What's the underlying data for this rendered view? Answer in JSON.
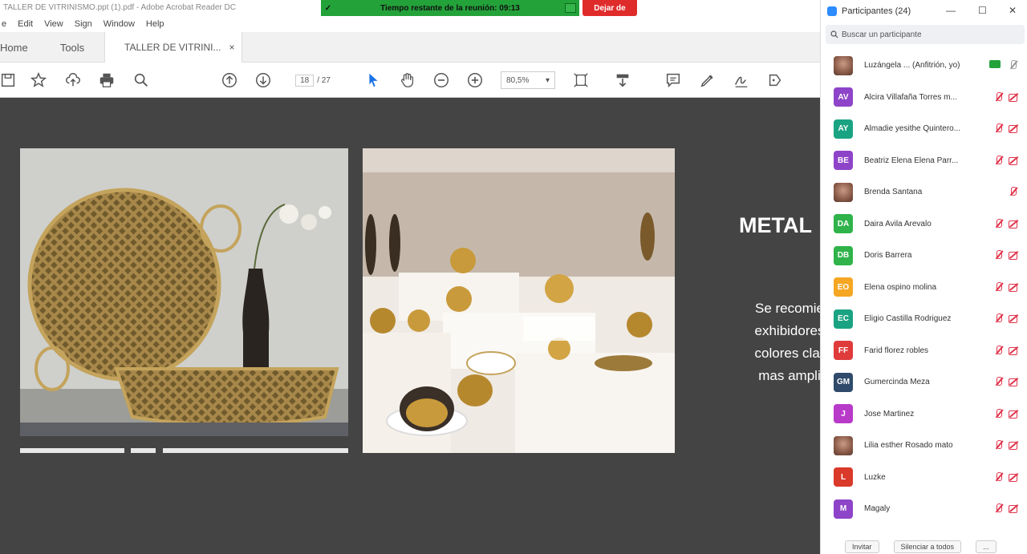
{
  "window": {
    "title": "TALLER DE VITRINISMO.ppt (1).pdf - Adobe Acrobat Reader DC",
    "meeting_banner": "Tiempo restante de la reunión: 09:13",
    "leave_label": "Dejar de"
  },
  "menu": [
    "e",
    "Edit",
    "View",
    "Sign",
    "Window",
    "Help"
  ],
  "tabs": {
    "home": "Home",
    "tools": "Tools",
    "doc": "TALLER DE VITRINI...",
    "doc_close": "×"
  },
  "toolbar": {
    "page_current": "18",
    "page_total": "/ 27",
    "zoom": "80,5%",
    "icons": [
      "save-icon",
      "bookmark-star-icon",
      "upload-icon",
      "print-icon",
      "search-icon",
      "page-up-icon",
      "page-down-icon",
      "select-arrow-icon",
      "hand-icon",
      "zoom-out-icon",
      "zoom-in-icon",
      "fit-page-icon",
      "scroll-icon",
      "comment-icon",
      "pen-icon",
      "sign-icon",
      "share-icon"
    ]
  },
  "slide": {
    "title": "METAL",
    "body_lines": [
      "Se recomie",
      "exhibidores",
      "colores clar",
      "mas ampli"
    ]
  },
  "panel": {
    "title": "Participantes (24)",
    "search_placeholder": "Buscar un participante",
    "participants": [
      {
        "initials": "",
        "name": "Luzángela ... (Anfitrión, yo)",
        "color": "",
        "photo": true,
        "host": true
      },
      {
        "initials": "AV",
        "name": "Alcira Villafaña Torres m...",
        "color": "#8e44c9"
      },
      {
        "initials": "AY",
        "name": "Almadie yesithe Quintero...",
        "color": "#1aa382"
      },
      {
        "initials": "BE",
        "name": "Beatriz Elena Elena Parr...",
        "color": "#8e44c9"
      },
      {
        "initials": "",
        "name": "Brenda Santana",
        "color": "",
        "photo": true
      },
      {
        "initials": "DA",
        "name": "Daira Avila Arevalo",
        "color": "#2fb34a"
      },
      {
        "initials": "DB",
        "name": "Doris Barrera",
        "color": "#2fb34a"
      },
      {
        "initials": "EO",
        "name": "Elena ospino molina",
        "color": "#f5a623"
      },
      {
        "initials": "EC",
        "name": "Eligio Castilla Rodriguez",
        "color": "#1aa382"
      },
      {
        "initials": "FF",
        "name": "Farid florez robles",
        "color": "#e03b3b"
      },
      {
        "initials": "GM",
        "name": "Gumercinda Meza",
        "color": "#2f4a6b"
      },
      {
        "initials": "J",
        "name": "Jose Martinez",
        "color": "#b83ac9"
      },
      {
        "initials": "",
        "name": "Lilia esther Rosado mato",
        "color": "",
        "photo": true
      },
      {
        "initials": "L",
        "name": "Luzke",
        "color": "#d93a2a"
      },
      {
        "initials": "M",
        "name": "Magaly",
        "color": "#8e44c9"
      }
    ],
    "invite_label": "Invitar",
    "mute_all_label": "Silenciar a todos",
    "more_label": "..."
  }
}
